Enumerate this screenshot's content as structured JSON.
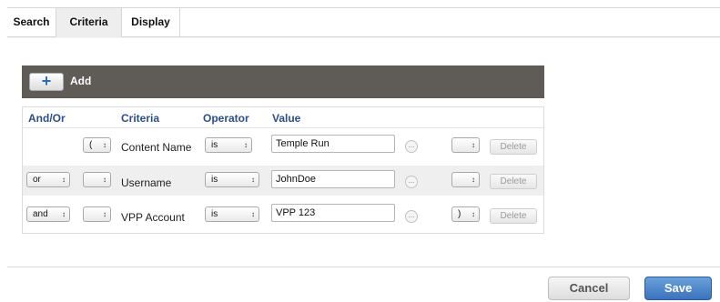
{
  "tabs": [
    {
      "label": "Search"
    },
    {
      "label": "Criteria"
    },
    {
      "label": "Display"
    }
  ],
  "toolbar": {
    "add_icon": "+",
    "add_label": "Add"
  },
  "table": {
    "headers": {
      "and_or": "And/Or",
      "criteria": "Criteria",
      "operator": "Operator",
      "value": "Value"
    },
    "rows": [
      {
        "and_or": "",
        "open_paren": "(",
        "criteria": "Content Name",
        "operator": "is",
        "value": "Temple Run",
        "close_paren": "",
        "delete": "Delete"
      },
      {
        "and_or": "or",
        "open_paren": "",
        "criteria": "Username",
        "operator": "is",
        "value": "JohnDoe",
        "close_paren": "",
        "delete": "Delete"
      },
      {
        "and_or": "and",
        "open_paren": "",
        "criteria": "VPP Account",
        "operator": "is",
        "value": "VPP 123",
        "close_paren": ")",
        "delete": "Delete"
      }
    ],
    "ellipsis": "..."
  },
  "footer": {
    "cancel": "Cancel",
    "save": "Save"
  },
  "icons": {
    "select_arrow": "updown-arrow-icon",
    "add": "plus-icon",
    "more": "ellipsis-icon"
  },
  "colors": {
    "accent": "#3a73bd",
    "toolbar": "#5f5c58",
    "header_text": "#2c4f86"
  }
}
